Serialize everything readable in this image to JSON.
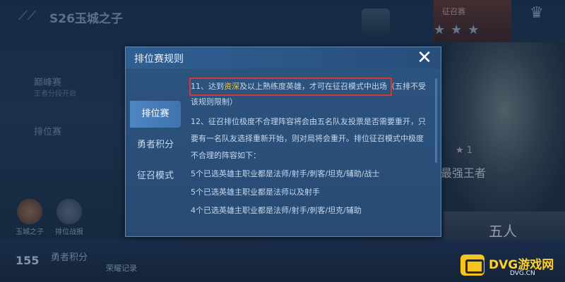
{
  "background": {
    "season_title": "S26玉城之子",
    "banner_label": "征召赛",
    "left_menu": {
      "item1": "巅峰赛",
      "item1_sub": "王者分段开启",
      "item2": "排位赛"
    },
    "avatars": [
      "玉城之子",
      "排位战报"
    ],
    "level_star": "★ 1",
    "rank_name": "最强王者",
    "party_button": "五人",
    "brave_points_value": "155",
    "brave_points_label": "勇者积分",
    "honor_record": "荣耀记录"
  },
  "modal": {
    "title": "排位赛规则",
    "close_icon": "close-icon",
    "tabs": [
      {
        "label": "排位赛",
        "active": true
      },
      {
        "label": "勇者积分",
        "active": false
      },
      {
        "label": "征召模式",
        "active": false
      }
    ],
    "rules": {
      "r11_prefix": "11、达到",
      "r11_highlight": "资深",
      "r11_suffix": "及以上熟练度英雄，才可在征召模式中出场（五排不受",
      "r11_line2": "该规则限制）",
      "r12_line1": "12、征召排位极度不合理阵容将会由五名队友投票是否需要重开，只",
      "r12_line2": "要有一名队友选择重新开始，则对局将会重开。排位征召模式中极度",
      "r12_line3": "不合理的阵容如下：",
      "case1": "5个已选英雄主职业都是法师/射手/刺客/坦克/辅助/战士",
      "case2": "5个已选英雄主职业都是法师以及射手",
      "case3": "4个已选英雄主职业都是法师/射手/刺客/坦克/辅助"
    }
  },
  "watermark": {
    "name": "DVG游戏网",
    "url": "DVG.CN"
  },
  "colors": {
    "highlight_text": "#f0c24a",
    "annotation_box": "#d23a3a",
    "active_tab": "#4f86c2"
  }
}
